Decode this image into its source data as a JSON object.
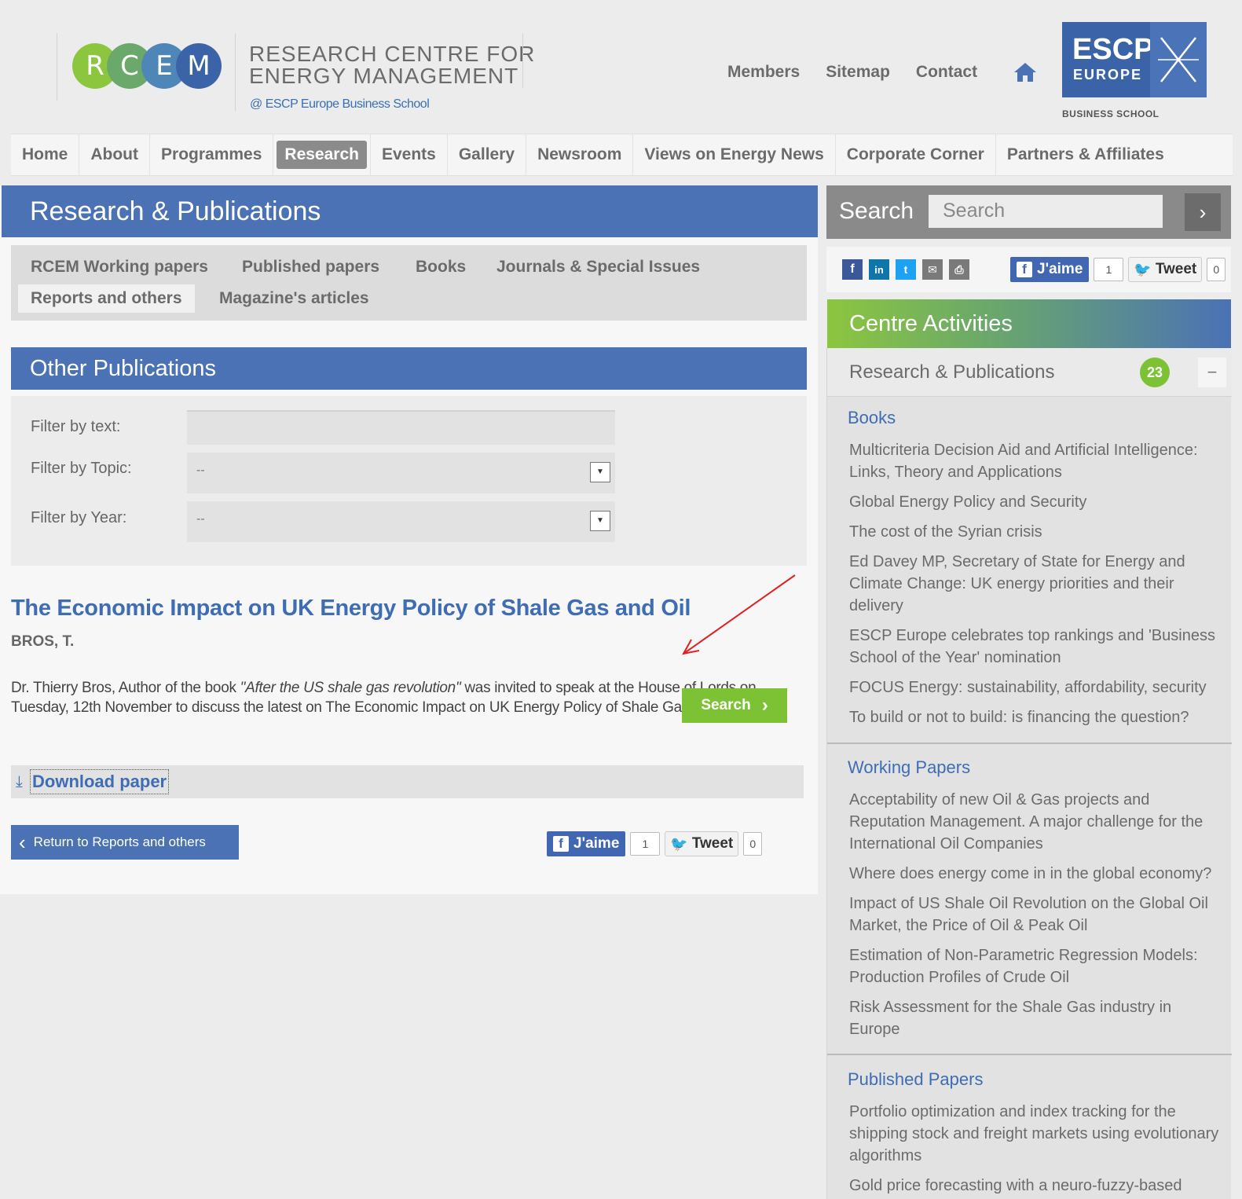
{
  "header": {
    "logo_letters": [
      "R",
      "C",
      "E",
      "M"
    ],
    "logo_colors": [
      "#8cc63f",
      "#6aa86b",
      "#4f86b8",
      "#3b63a7"
    ],
    "title_line1": "RESEARCH CENTRE FOR",
    "title_line2": "ENERGY MANAGEMENT",
    "subtitle": "@ ESCP Europe Business School",
    "links": [
      "Members",
      "Sitemap",
      "Contact"
    ],
    "escp_line1": "ESCP",
    "escp_line2": "EUROPE",
    "escp_caption": "BUSINESS SCHOOL"
  },
  "nav": {
    "items": [
      "Home",
      "About",
      "Programmes",
      "Research",
      "Events",
      "Gallery",
      "Newsroom",
      "Views on Energy News",
      "Corporate Corner",
      "Partners & Affiliates"
    ],
    "active": "Research"
  },
  "main": {
    "banner": "Research & Publications",
    "tabs": [
      "RCEM Working papers",
      "Published papers",
      "Books",
      "Journals & Special Issues",
      "Reports and others",
      "Magazine's articles"
    ],
    "selected_tab": "Reports and others",
    "section_title": "Other Publications",
    "filters": {
      "text_label": "Filter by text:",
      "topic_label": "Filter by Topic:",
      "year_label": "Filter by Year:",
      "topic_value": "--",
      "year_value": "--",
      "search_button": "Search"
    },
    "article": {
      "title": "The Economic Impact on UK Energy Policy of Shale Gas and Oil",
      "author": "BROS, T.",
      "body_1": "Dr. Thierry Bros, Author of the book ",
      "body_book": "\"After the US shale gas revolution\"",
      "body_2": " was invited to speak at the House of Lords on Tuesday, 12th November  to discuss the latest on The Economic Impact on UK Energy Policy of Shale Gas and Oil.",
      "download": "Download paper"
    },
    "return_button": "Return to Reports and others",
    "like_label": "J'aime",
    "like_count": "1",
    "tweet_label": "Tweet",
    "tweet_count": "0"
  },
  "sidebar": {
    "search_label": "Search",
    "search_placeholder": "Search",
    "like_label": "J'aime",
    "like_count": "1",
    "tweet_label": "Tweet",
    "tweet_count": "0",
    "share_icons": [
      "facebook-icon",
      "linkedin-icon",
      "twitter-icon",
      "email-icon",
      "print-icon"
    ],
    "activities_title": "Centre Activities",
    "research_label": "Research & Publications",
    "research_count": "23",
    "collapse_symbol": "−",
    "books_title": "Books",
    "books": [
      "Multicriteria Decision Aid and Artificial Intelligence: Links, Theory and Applications",
      "Global Energy Policy and Security",
      "The cost of the Syrian crisis",
      "Ed Davey MP, Secretary of State for Energy and Climate Change: UK energy priorities and their delivery",
      "ESCP Europe celebrates top rankings and 'Business School of the Year' nomination",
      "FOCUS Energy: sustainability, affordability, security",
      "To build or not to build: is financing the question?"
    ],
    "working_title": "Working Papers",
    "working": [
      "Acceptability of new Oil & Gas projects and Reputation Management. A major challenge for the International Oil Companies",
      "Where does energy come in in the global economy?",
      "Impact of US Shale Oil Revolution on the Global Oil Market, the Price of Oil & Peak Oil",
      "Estimation of Non-Parametric Regression Models: Production Profiles of Crude Oil",
      "Risk Assessment for the Shale Gas industry in Europe"
    ],
    "published_title": "Published Papers",
    "published": [
      "Portfolio optimization and index tracking for the shipping stock and freight markets using evolutionary algorithms",
      "Gold price forecasting with a neuro-fuzzy-based"
    ]
  },
  "colors": {
    "brand_blue": "#4a72b5",
    "link_blue": "#3e6db3",
    "green": "#7cc234",
    "annotation_red": "#e02020"
  }
}
